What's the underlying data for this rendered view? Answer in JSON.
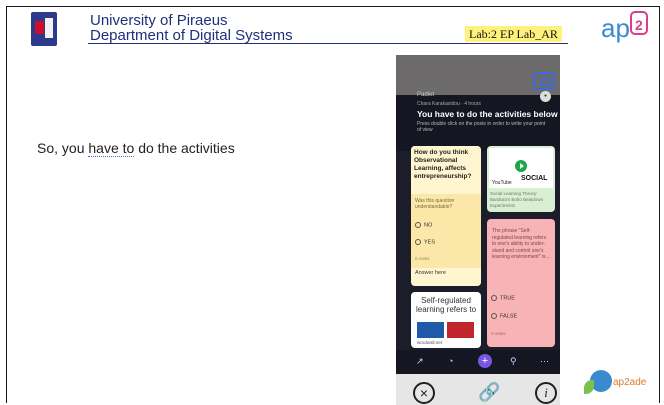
{
  "header": {
    "university_line1": "University of Piraeus",
    "university_line2": "Department of Digital Systems",
    "lab_label": "Lab:2 EP Lab_AR",
    "brand_logo": "ap2",
    "logo_icon": "university-crest"
  },
  "slide": {
    "body_text_before": "So, you ",
    "body_text_underlined": "have to",
    "body_text_after": " do the activities"
  },
  "padlet": {
    "app_name": "Padlet",
    "author": "Chara Karakasidou · 4 hours",
    "title": "You have to do the activities below",
    "subtitle": "Press double click on the posts in order to write your point of view",
    "cards": {
      "observational": {
        "heading": "How do you think Observational Learning, affects entrepreneurship?",
        "question_prompt": "Was this question understandable?",
        "option_no": "NO",
        "option_yes": "YES",
        "votes": "0 votes",
        "answer_label": "Answer here"
      },
      "video": {
        "brand": "YouTube",
        "thumb_text": "SOCIAL",
        "caption": "Social Learning Theory: Bandura's Bobo Beatdown Experiments"
      },
      "quiz": {
        "statement": "The phrase \"Self-regulated learning refers to one's ability to under- stand and control one's learning environment\" is...",
        "option_true": "TRUE",
        "option_false": "FALSE",
        "votes": "0 votes"
      },
      "wordwall": {
        "title": "Self-regulated learning refers to",
        "caption": "wordwall.net"
      }
    }
  },
  "footer": {
    "brand": "ap2ade"
  }
}
